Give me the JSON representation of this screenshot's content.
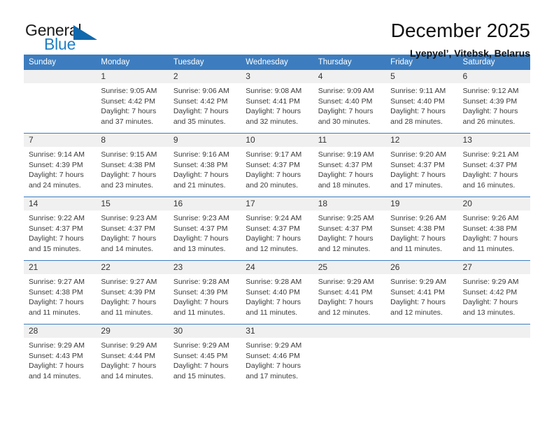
{
  "brand": {
    "word_one": "General",
    "word_two": "Blue",
    "triangle_color": "#1068ad",
    "blue_text_color": "#1f7fc4",
    "icon": "general-blue-logo"
  },
  "header": {
    "month_title": "December 2025",
    "location": "Lyepyel’, Vitebsk, Belarus"
  },
  "theme": {
    "header_row_bg": "#3d7dbf",
    "header_row_text": "#ffffff",
    "day_band_bg": "#f0f0f0",
    "grid_line": "#3d7dbf",
    "body_text": "#3a3a3a"
  },
  "weekday_headers": [
    "Sunday",
    "Monday",
    "Tuesday",
    "Wednesday",
    "Thursday",
    "Friday",
    "Saturday"
  ],
  "weeks": [
    [
      {
        "day": "",
        "sunrise": "",
        "sunset": "",
        "daylight_line1": "",
        "daylight_line2": ""
      },
      {
        "day": "1",
        "sunrise": "Sunrise: 9:05 AM",
        "sunset": "Sunset: 4:42 PM",
        "daylight_line1": "Daylight: 7 hours",
        "daylight_line2": "and 37 minutes."
      },
      {
        "day": "2",
        "sunrise": "Sunrise: 9:06 AM",
        "sunset": "Sunset: 4:42 PM",
        "daylight_line1": "Daylight: 7 hours",
        "daylight_line2": "and 35 minutes."
      },
      {
        "day": "3",
        "sunrise": "Sunrise: 9:08 AM",
        "sunset": "Sunset: 4:41 PM",
        "daylight_line1": "Daylight: 7 hours",
        "daylight_line2": "and 32 minutes."
      },
      {
        "day": "4",
        "sunrise": "Sunrise: 9:09 AM",
        "sunset": "Sunset: 4:40 PM",
        "daylight_line1": "Daylight: 7 hours",
        "daylight_line2": "and 30 minutes."
      },
      {
        "day": "5",
        "sunrise": "Sunrise: 9:11 AM",
        "sunset": "Sunset: 4:40 PM",
        "daylight_line1": "Daylight: 7 hours",
        "daylight_line2": "and 28 minutes."
      },
      {
        "day": "6",
        "sunrise": "Sunrise: 9:12 AM",
        "sunset": "Sunset: 4:39 PM",
        "daylight_line1": "Daylight: 7 hours",
        "daylight_line2": "and 26 minutes."
      }
    ],
    [
      {
        "day": "7",
        "sunrise": "Sunrise: 9:14 AM",
        "sunset": "Sunset: 4:39 PM",
        "daylight_line1": "Daylight: 7 hours",
        "daylight_line2": "and 24 minutes."
      },
      {
        "day": "8",
        "sunrise": "Sunrise: 9:15 AM",
        "sunset": "Sunset: 4:38 PM",
        "daylight_line1": "Daylight: 7 hours",
        "daylight_line2": "and 23 minutes."
      },
      {
        "day": "9",
        "sunrise": "Sunrise: 9:16 AM",
        "sunset": "Sunset: 4:38 PM",
        "daylight_line1": "Daylight: 7 hours",
        "daylight_line2": "and 21 minutes."
      },
      {
        "day": "10",
        "sunrise": "Sunrise: 9:17 AM",
        "sunset": "Sunset: 4:37 PM",
        "daylight_line1": "Daylight: 7 hours",
        "daylight_line2": "and 20 minutes."
      },
      {
        "day": "11",
        "sunrise": "Sunrise: 9:19 AM",
        "sunset": "Sunset: 4:37 PM",
        "daylight_line1": "Daylight: 7 hours",
        "daylight_line2": "and 18 minutes."
      },
      {
        "day": "12",
        "sunrise": "Sunrise: 9:20 AM",
        "sunset": "Sunset: 4:37 PM",
        "daylight_line1": "Daylight: 7 hours",
        "daylight_line2": "and 17 minutes."
      },
      {
        "day": "13",
        "sunrise": "Sunrise: 9:21 AM",
        "sunset": "Sunset: 4:37 PM",
        "daylight_line1": "Daylight: 7 hours",
        "daylight_line2": "and 16 minutes."
      }
    ],
    [
      {
        "day": "14",
        "sunrise": "Sunrise: 9:22 AM",
        "sunset": "Sunset: 4:37 PM",
        "daylight_line1": "Daylight: 7 hours",
        "daylight_line2": "and 15 minutes."
      },
      {
        "day": "15",
        "sunrise": "Sunrise: 9:23 AM",
        "sunset": "Sunset: 4:37 PM",
        "daylight_line1": "Daylight: 7 hours",
        "daylight_line2": "and 14 minutes."
      },
      {
        "day": "16",
        "sunrise": "Sunrise: 9:23 AM",
        "sunset": "Sunset: 4:37 PM",
        "daylight_line1": "Daylight: 7 hours",
        "daylight_line2": "and 13 minutes."
      },
      {
        "day": "17",
        "sunrise": "Sunrise: 9:24 AM",
        "sunset": "Sunset: 4:37 PM",
        "daylight_line1": "Daylight: 7 hours",
        "daylight_line2": "and 12 minutes."
      },
      {
        "day": "18",
        "sunrise": "Sunrise: 9:25 AM",
        "sunset": "Sunset: 4:37 PM",
        "daylight_line1": "Daylight: 7 hours",
        "daylight_line2": "and 12 minutes."
      },
      {
        "day": "19",
        "sunrise": "Sunrise: 9:26 AM",
        "sunset": "Sunset: 4:38 PM",
        "daylight_line1": "Daylight: 7 hours",
        "daylight_line2": "and 11 minutes."
      },
      {
        "day": "20",
        "sunrise": "Sunrise: 9:26 AM",
        "sunset": "Sunset: 4:38 PM",
        "daylight_line1": "Daylight: 7 hours",
        "daylight_line2": "and 11 minutes."
      }
    ],
    [
      {
        "day": "21",
        "sunrise": "Sunrise: 9:27 AM",
        "sunset": "Sunset: 4:38 PM",
        "daylight_line1": "Daylight: 7 hours",
        "daylight_line2": "and 11 minutes."
      },
      {
        "day": "22",
        "sunrise": "Sunrise: 9:27 AM",
        "sunset": "Sunset: 4:39 PM",
        "daylight_line1": "Daylight: 7 hours",
        "daylight_line2": "and 11 minutes."
      },
      {
        "day": "23",
        "sunrise": "Sunrise: 9:28 AM",
        "sunset": "Sunset: 4:39 PM",
        "daylight_line1": "Daylight: 7 hours",
        "daylight_line2": "and 11 minutes."
      },
      {
        "day": "24",
        "sunrise": "Sunrise: 9:28 AM",
        "sunset": "Sunset: 4:40 PM",
        "daylight_line1": "Daylight: 7 hours",
        "daylight_line2": "and 11 minutes."
      },
      {
        "day": "25",
        "sunrise": "Sunrise: 9:29 AM",
        "sunset": "Sunset: 4:41 PM",
        "daylight_line1": "Daylight: 7 hours",
        "daylight_line2": "and 12 minutes."
      },
      {
        "day": "26",
        "sunrise": "Sunrise: 9:29 AM",
        "sunset": "Sunset: 4:41 PM",
        "daylight_line1": "Daylight: 7 hours",
        "daylight_line2": "and 12 minutes."
      },
      {
        "day": "27",
        "sunrise": "Sunrise: 9:29 AM",
        "sunset": "Sunset: 4:42 PM",
        "daylight_line1": "Daylight: 7 hours",
        "daylight_line2": "and 13 minutes."
      }
    ],
    [
      {
        "day": "28",
        "sunrise": "Sunrise: 9:29 AM",
        "sunset": "Sunset: 4:43 PM",
        "daylight_line1": "Daylight: 7 hours",
        "daylight_line2": "and 14 minutes."
      },
      {
        "day": "29",
        "sunrise": "Sunrise: 9:29 AM",
        "sunset": "Sunset: 4:44 PM",
        "daylight_line1": "Daylight: 7 hours",
        "daylight_line2": "and 14 minutes."
      },
      {
        "day": "30",
        "sunrise": "Sunrise: 9:29 AM",
        "sunset": "Sunset: 4:45 PM",
        "daylight_line1": "Daylight: 7 hours",
        "daylight_line2": "and 15 minutes."
      },
      {
        "day": "31",
        "sunrise": "Sunrise: 9:29 AM",
        "sunset": "Sunset: 4:46 PM",
        "daylight_line1": "Daylight: 7 hours",
        "daylight_line2": "and 17 minutes."
      },
      {
        "day": "",
        "sunrise": "",
        "sunset": "",
        "daylight_line1": "",
        "daylight_line2": ""
      },
      {
        "day": "",
        "sunrise": "",
        "sunset": "",
        "daylight_line1": "",
        "daylight_line2": ""
      },
      {
        "day": "",
        "sunrise": "",
        "sunset": "",
        "daylight_line1": "",
        "daylight_line2": ""
      }
    ]
  ]
}
